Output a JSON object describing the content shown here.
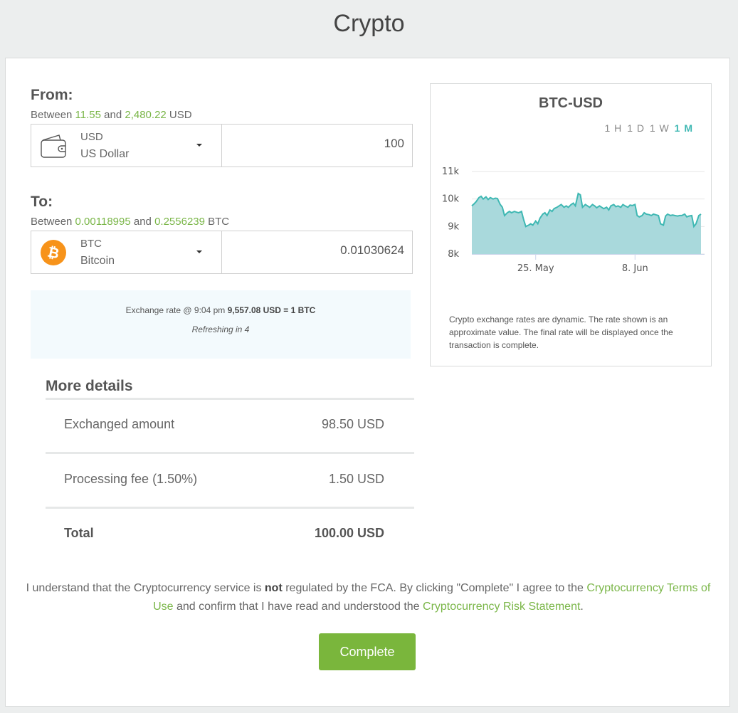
{
  "page": {
    "title": "Crypto"
  },
  "from": {
    "label": "From:",
    "between_prefix": "Between ",
    "min": "11.55",
    "and": " and ",
    "max": "2,480.22",
    "unit": " USD",
    "currency_code": "USD",
    "currency_name": "US Dollar",
    "amount": "100",
    "icon": "wallet-icon"
  },
  "to": {
    "label": "To:",
    "between_prefix": "Between ",
    "min": "0.00118995",
    "and": " and ",
    "max": "0.2556239",
    "unit": " BTC",
    "currency_code": "BTC",
    "currency_name": "Bitcoin",
    "amount": "0.01030624",
    "icon": "bitcoin-icon"
  },
  "rate": {
    "prefix": "Exchange rate @ 9:04 pm ",
    "value": "9,557.08 USD = 1 BTC",
    "refresh": "Refreshing in 4"
  },
  "details": {
    "title": "More details",
    "rows": [
      {
        "label": "Exchanged amount",
        "value": "98.50 USD"
      },
      {
        "label": "Processing fee (1.50%)",
        "value": "1.50 USD"
      },
      {
        "label": "Total",
        "value": "100.00 USD"
      }
    ]
  },
  "chart_panel": {
    "title": "BTC-USD",
    "ranges": [
      "1 H",
      "1 D",
      "1 W",
      "1 M"
    ],
    "active_range": "1 M",
    "note": "Crypto exchange rates are dynamic. The rate shown is an approximate value. The final rate will be displayed once the transaction is complete."
  },
  "chart_data": {
    "type": "area",
    "title": "BTC-USD",
    "ylim": [
      8000,
      11000
    ],
    "yticks": [
      8000,
      9000,
      10000,
      11000
    ],
    "ytick_labels": [
      "8k",
      "9k",
      "10k",
      "11k"
    ],
    "xtick_labels": [
      {
        "label": "25. May",
        "day": 9
      },
      {
        "label": "8. Jun",
        "day": 23
      }
    ],
    "grid": true,
    "color": "#3fb8b3",
    "fill": "#a9d9dc",
    "x": [
      0,
      0.3,
      0.6,
      1,
      1.3,
      1.6,
      2,
      2.3,
      2.6,
      3,
      3.3,
      3.6,
      4,
      4.3,
      4.6,
      5,
      5.3,
      5.6,
      6,
      6.3,
      6.6,
      7,
      7.3,
      7.6,
      8,
      8.3,
      8.6,
      9,
      9.3,
      9.6,
      10,
      10.3,
      10.6,
      11,
      11.3,
      11.6,
      12,
      12.3,
      12.6,
      13,
      13.3,
      13.6,
      14,
      14.3,
      14.6,
      15,
      15.3,
      15.6,
      16,
      16.3,
      16.6,
      17,
      17.3,
      17.6,
      18,
      18.3,
      18.6,
      19,
      19.3,
      19.6,
      20,
      20.3,
      20.6,
      21,
      21.3,
      21.6,
      22,
      22.3,
      22.6,
      23,
      23.3,
      23.6,
      24,
      24.3,
      24.6,
      25,
      25.3,
      25.6,
      26,
      26.3,
      26.6,
      27,
      27.3,
      27.6,
      28,
      28.3,
      28.6,
      29,
      29.3,
      29.6,
      30,
      30.3,
      30.6,
      31,
      31.3,
      31.6,
      32,
      32.3
    ],
    "values": [
      9750,
      9820,
      9900,
      10050,
      10100,
      10000,
      10080,
      9980,
      10050,
      10000,
      10030,
      10020,
      9800,
      9700,
      9400,
      9500,
      9550,
      9500,
      9550,
      9520,
      9500,
      9550,
      9250,
      9000,
      9050,
      9100,
      9050,
      9200,
      9100,
      9300,
      9450,
      9500,
      9400,
      9600,
      9550,
      9650,
      9700,
      9750,
      9800,
      9700,
      9750,
      9700,
      9800,
      9850,
      9750,
      10200,
      10150,
      9700,
      9800,
      9750,
      9700,
      9800,
      9750,
      9680,
      9750,
      9700,
      9650,
      9700,
      9600,
      9750,
      9800,
      9720,
      9750,
      9700,
      9800,
      9750,
      9700,
      9780,
      9760,
      9800,
      9400,
      9350,
      9400,
      9500,
      9450,
      9430,
      9400,
      9450,
      9420,
      9400,
      9100,
      9050,
      9380,
      9450,
      9400,
      9420,
      9400,
      9380,
      9400,
      9400,
      9450,
      9350,
      9380,
      9400,
      9000,
      9100,
      9400,
      9450
    ]
  },
  "legal": {
    "part1": "I understand that the Cryptocurrency service is ",
    "bold": "not",
    "part2": " regulated by the FCA. By clicking \"Complete\" I agree to the ",
    "link1": "Cryptocurrency Terms of Use",
    "part3": " and confirm that I have read and understood the ",
    "link2": "Cryptocurrency Risk Statement",
    "part4": "."
  },
  "actions": {
    "complete_label": "Complete"
  },
  "colors": {
    "accent_green": "#7ab648",
    "chart_teal": "#3fb8b3",
    "button_green": "#7ab63c"
  }
}
